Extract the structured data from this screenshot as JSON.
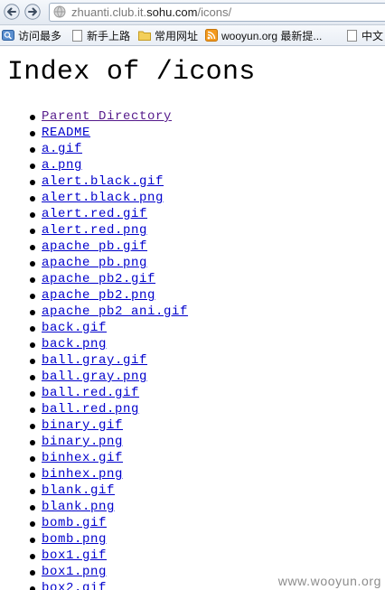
{
  "browser": {
    "url_prefix": "zhuanti.club.it.",
    "url_host": "sohu.com",
    "url_path": "/icons/",
    "bookmarks": [
      {
        "label": "访问最多",
        "icon": "most-visited-icon"
      },
      {
        "label": "新手上路",
        "icon": "page-icon"
      },
      {
        "label": "常用网址",
        "icon": "folder-icon"
      },
      {
        "label": "wooyun.org 最新提...",
        "icon": "rss-icon"
      },
      {
        "label": "中文",
        "icon": "page-icon"
      }
    ]
  },
  "page": {
    "title": "Index of /icons",
    "items": [
      "Parent Directory",
      "README",
      "a.gif",
      "a.png",
      "alert.black.gif",
      "alert.black.png",
      "alert.red.gif",
      "alert.red.png",
      "apache_pb.gif",
      "apache_pb.png",
      "apache_pb2.gif",
      "apache_pb2.png",
      "apache_pb2_ani.gif",
      "back.gif",
      "back.png",
      "ball.gray.gif",
      "ball.gray.png",
      "ball.red.gif",
      "ball.red.png",
      "binary.gif",
      "binary.png",
      "binhex.gif",
      "binhex.png",
      "blank.gif",
      "blank.png",
      "bomb.gif",
      "bomb.png",
      "box1.gif",
      "box1.png",
      "box2.gif"
    ]
  },
  "watermark": "www.wooyun.org",
  "colors": {
    "link": "#0000cc",
    "visited_link": "#551a8b"
  }
}
